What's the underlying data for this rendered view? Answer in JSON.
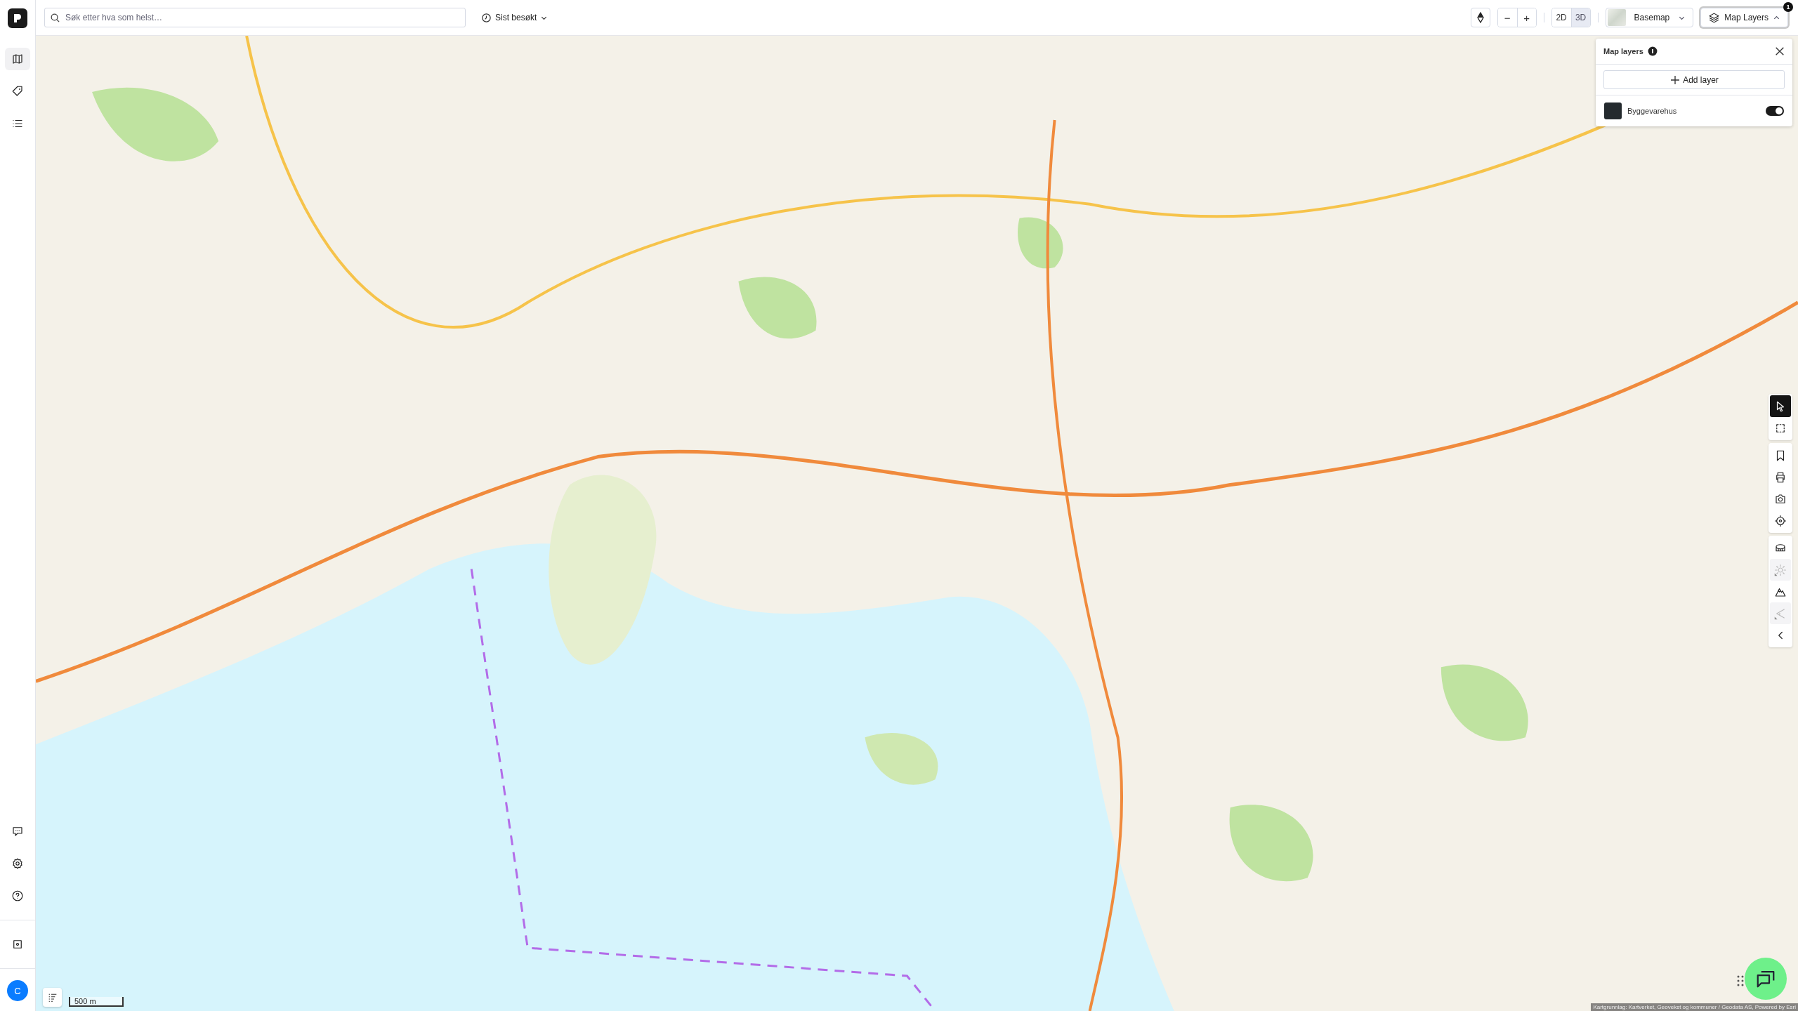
{
  "sidebar": {
    "items": [
      {
        "kind": "map",
        "selected": true
      },
      {
        "kind": "tag",
        "selected": false
      },
      {
        "kind": "list",
        "selected": false
      }
    ],
    "bottom_items": [
      {
        "kind": "chat"
      },
      {
        "kind": "settings"
      },
      {
        "kind": "help"
      },
      {
        "kind": "record"
      }
    ],
    "avatar": {
      "initial": "C"
    }
  },
  "top_bar": {
    "search": {
      "placeholder": "Søk etter hva som helst…"
    },
    "recent": {
      "label": "Sist besøkt"
    },
    "zoom_out": "−",
    "zoom_in": "+",
    "view_modes": [
      {
        "label": "2D",
        "selected": false
      },
      {
        "label": "3D",
        "selected": true
      }
    ],
    "basemap": {
      "label": "Basemap"
    },
    "map_layers": {
      "label": "Map Layers",
      "badge": "1",
      "expanded": true
    }
  },
  "layers_panel": {
    "title": "Map layers",
    "add_button": "Add layer",
    "layers": [
      {
        "name": "Byggevarehus",
        "on": true
      }
    ]
  },
  "tools": [
    [
      {
        "kind": "pointer",
        "selected": true,
        "disabled": false
      },
      {
        "kind": "select-area",
        "selected": false,
        "disabled": false
      }
    ],
    [
      {
        "kind": "bookmark",
        "selected": false,
        "disabled": false
      },
      {
        "kind": "print",
        "selected": false,
        "disabled": false
      },
      {
        "kind": "camera",
        "selected": false,
        "disabled": false
      },
      {
        "kind": "locate",
        "selected": false,
        "disabled": false
      }
    ],
    [
      {
        "kind": "measure",
        "selected": false,
        "disabled": false
      },
      {
        "kind": "sun",
        "selected": false,
        "disabled": true
      },
      {
        "kind": "terrain",
        "selected": false,
        "disabled": false
      },
      {
        "kind": "angle",
        "selected": false,
        "disabled": true
      },
      {
        "kind": "collapse",
        "selected": false,
        "disabled": false
      }
    ]
  ],
  "map": {
    "scale": "500 m",
    "attribution": "Kartgrunnlag: Kartverket, Geovekst og kommuner / Geodata AS, Powered by Esri"
  }
}
